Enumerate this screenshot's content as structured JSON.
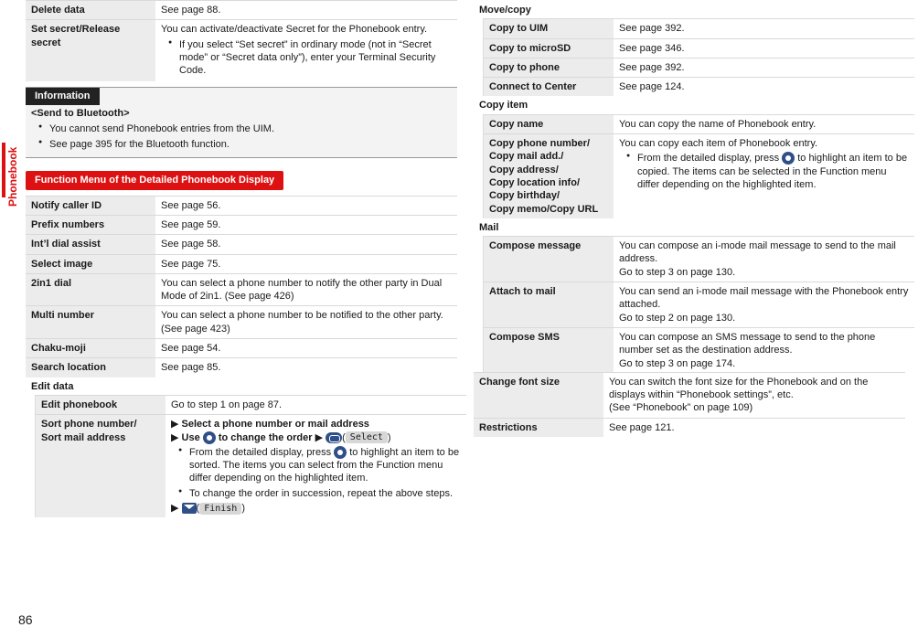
{
  "sideTab": "Phonebook",
  "pageNum": "86",
  "left": {
    "topRows": [
      {
        "name": "Delete data",
        "desc": "See page 88."
      },
      {
        "name": "Set secret/Release secret",
        "desc": "You can activate/deactivate Secret for the Phonebook entry.",
        "bullets": [
          "If you select “Set secret” in ordinary mode (not in “Secret mode” or “Secret data only”), enter your Terminal Security Code."
        ]
      }
    ],
    "infoTitle": "Information",
    "infoHead": "<Send to Bluetooth>",
    "infoBullets": [
      "You cannot send Phonebook entries from the UIM.",
      "See page 395 for the Bluetooth function."
    ],
    "sectionHeader": "Function Menu of the Detailed Phonebook Display",
    "rows": [
      {
        "name": "Notify caller ID",
        "desc": "See page 56."
      },
      {
        "name": "Prefix numbers",
        "desc": "See page 59."
      },
      {
        "name": "Int’l dial assist",
        "desc": "See page 58."
      },
      {
        "name": "Select image",
        "desc": "See page 75."
      },
      {
        "name": "2in1 dial",
        "desc": "You can select a phone number to notify the other party in Dual Mode of 2in1. (See page 426)"
      },
      {
        "name": "Multi number",
        "desc": "You can select a phone number to be notified to the other party. (See page 423)"
      },
      {
        "name": "Chaku-moji",
        "desc": "See page 54."
      },
      {
        "name": "Search location",
        "desc": "See page 85."
      }
    ],
    "editHeader": "Edit data",
    "editRows": [
      {
        "name": "Edit phonebook",
        "desc": "Go to step 1 on page 87."
      }
    ],
    "sort": {
      "name": "Sort phone number/\nSort mail address",
      "step1": "Select a phone number or mail address",
      "step2a": "Use",
      "step2b": " to change the order",
      "btnSelect": "Select",
      "bullets": [
        "From the detailed display, press __DISC__ to highlight an item to be sorted. The items you can select from the Function menu differ depending on the highlighted item.",
        "To change the order in succession, repeat the above steps."
      ],
      "btnFinish": "Finish"
    }
  },
  "right": {
    "moveHeader": "Move/copy",
    "moveRows": [
      {
        "name": "Copy to UIM",
        "desc": "See page 392."
      },
      {
        "name": "Copy to microSD",
        "desc": "See page 346."
      },
      {
        "name": "Copy to phone",
        "desc": "See page 392."
      },
      {
        "name": "Connect to Center",
        "desc": "See page 124."
      }
    ],
    "copyHeader": "Copy item",
    "copyRows": [
      {
        "name": "Copy name",
        "desc": "You can copy the name of Phonebook entry."
      }
    ],
    "copyMulti": {
      "name": "Copy phone number/\nCopy mail add./\nCopy address/\nCopy location info/\nCopy birthday/\nCopy memo/Copy URL",
      "desc": "You can copy each item of Phonebook entry.",
      "bullet": "From the detailed display, press __DISC__ to highlight an item to be copied. The items can be selected in the Function menu differ depending on the highlighted item."
    },
    "mailHeader": "Mail",
    "mailRows": [
      {
        "name": "Compose message",
        "desc": "You can compose an i-mode mail message to send to the mail address.\nGo to step 3 on page 130."
      },
      {
        "name": "Attach to mail",
        "desc": "You can send an i-mode mail message with the Phonebook entry attached.\nGo to step 2 on page 130."
      },
      {
        "name": "Compose SMS",
        "desc": "You can compose an SMS message to send to the phone number set as the destination address.\nGo to step 3 on page 174."
      }
    ],
    "bottomRows": [
      {
        "name": "Change font size",
        "desc": "You can switch the font size for the Phonebook and on the displays within “Phonebook settings”, etc.\n(See “Phonebook” on page 109)"
      },
      {
        "name": "Restrictions",
        "desc": "See page 121."
      }
    ]
  }
}
